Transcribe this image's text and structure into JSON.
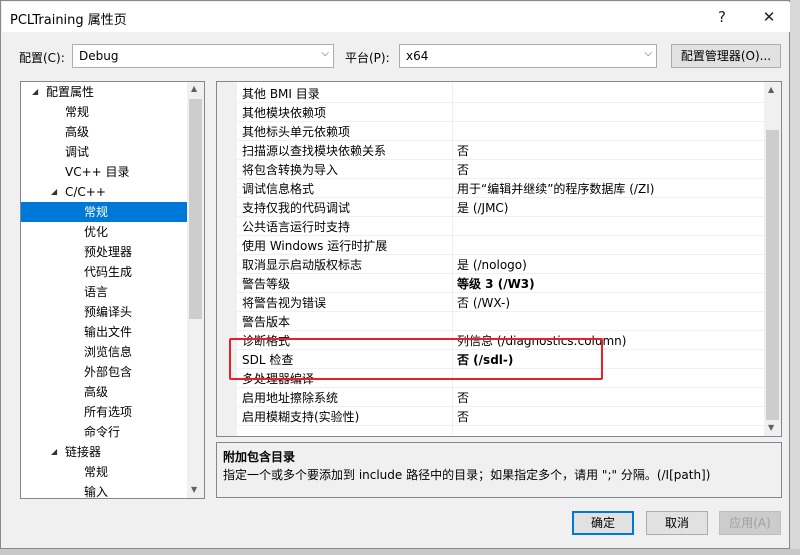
{
  "window": {
    "title": "PCLTraining 属性页",
    "help_glyph": "?",
    "close_glyph": "✕"
  },
  "config": {
    "config_label": "配置(C):",
    "config_value": "Debug",
    "platform_label": "平台(P):",
    "platform_value": "x64",
    "manager_button": "配置管理器(O)..."
  },
  "tree": {
    "items": [
      {
        "label": "配置属性"
      },
      {
        "label": "常规"
      },
      {
        "label": "高级"
      },
      {
        "label": "调试"
      },
      {
        "label": "VC++ 目录"
      },
      {
        "label": "C/C++"
      },
      {
        "label": "常规"
      },
      {
        "label": "优化"
      },
      {
        "label": "预处理器"
      },
      {
        "label": "代码生成"
      },
      {
        "label": "语言"
      },
      {
        "label": "预编译头"
      },
      {
        "label": "输出文件"
      },
      {
        "label": "浏览信息"
      },
      {
        "label": "外部包含"
      },
      {
        "label": "高级"
      },
      {
        "label": "所有选项"
      },
      {
        "label": "命令行"
      },
      {
        "label": "链接器"
      },
      {
        "label": "常规"
      },
      {
        "label": "输入"
      }
    ]
  },
  "properties": {
    "rows": [
      {
        "name": "其他 BMI 目录",
        "value": ""
      },
      {
        "name": "其他模块依赖项",
        "value": ""
      },
      {
        "name": "其他标头单元依赖项",
        "value": ""
      },
      {
        "name": "扫描源以查找模块依赖关系",
        "value": "否"
      },
      {
        "name": "将包含转换为导入",
        "value": "否"
      },
      {
        "name": "调试信息格式",
        "value": "用于“编辑并继续”的程序数据库 (/ZI)"
      },
      {
        "name": "支持仅我的代码调试",
        "value": "是 (/JMC)"
      },
      {
        "name": "公共语言运行时支持",
        "value": ""
      },
      {
        "name": "使用 Windows 运行时扩展",
        "value": ""
      },
      {
        "name": "取消显示启动版权标志",
        "value": "是 (/nologo)"
      },
      {
        "name": "警告等级",
        "value": "等级 3 (/W3)"
      },
      {
        "name": "将警告视为错误",
        "value": "否 (/WX-)"
      },
      {
        "name": "警告版本",
        "value": ""
      },
      {
        "name": "诊断格式",
        "value": "列信息 (/diagnostics:column)"
      },
      {
        "name": "SDL 检查",
        "value": "否 (/sdl-)"
      },
      {
        "name": "多处理器编译",
        "value": ""
      },
      {
        "name": "启用地址擦除系统",
        "value": "否"
      },
      {
        "name": "启用模糊支持(实验性)",
        "value": "否"
      }
    ]
  },
  "description": {
    "title": "附加包含目录",
    "text": "指定一个或多个要添加到 include 路径中的目录；如果指定多个，请用 \";\" 分隔。(/I[path])"
  },
  "buttons": {
    "ok": "确定",
    "cancel": "取消",
    "apply": "应用(A)"
  },
  "colors": {
    "selection": "#0078d7",
    "highlight_box": "#e8202a"
  }
}
